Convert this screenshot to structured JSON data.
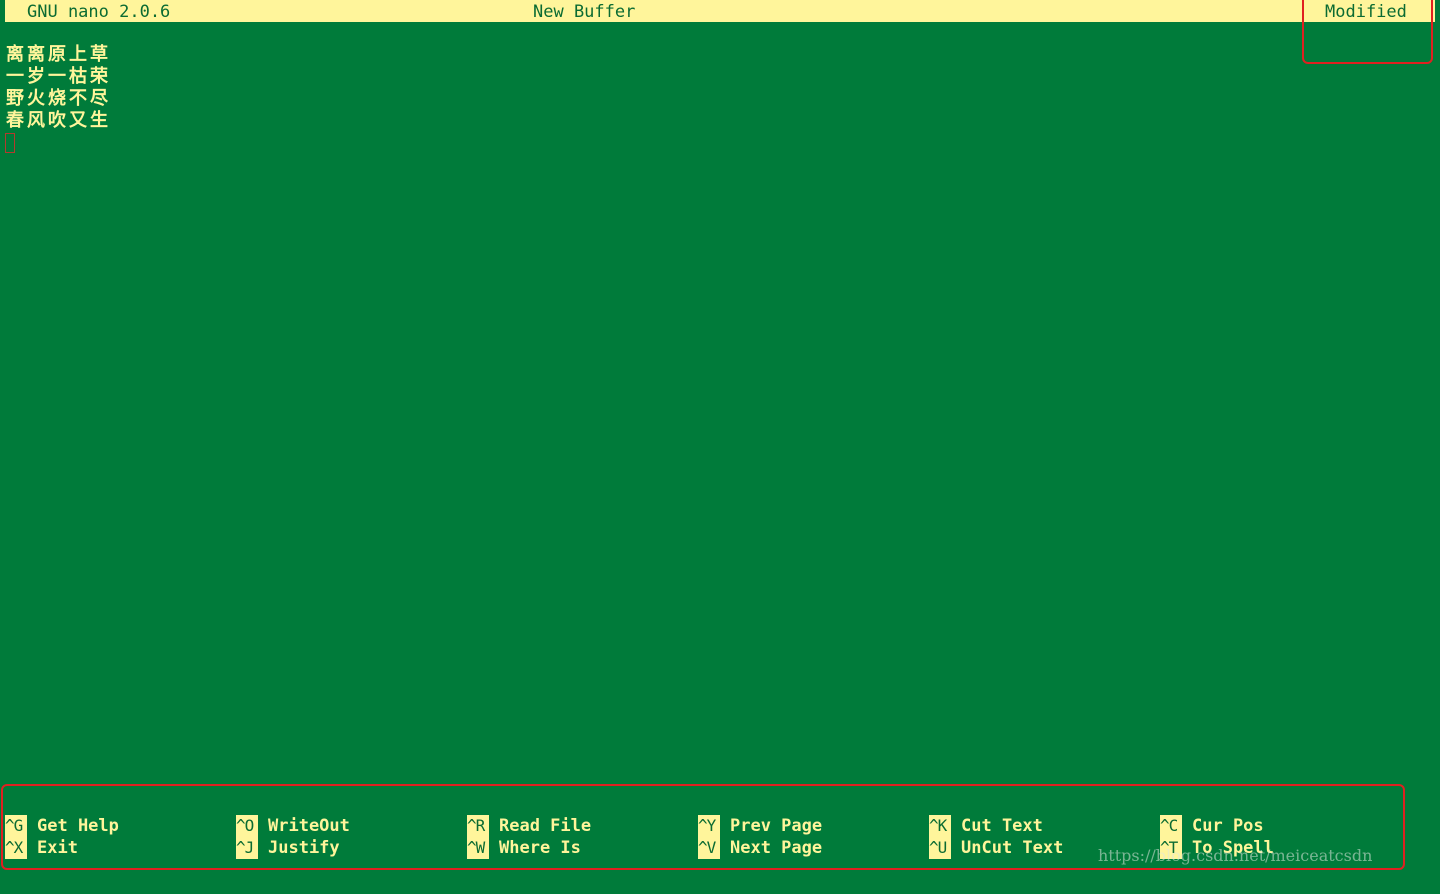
{
  "titlebar": {
    "app": "GNU nano 2.0.6",
    "buffer": "New Buffer",
    "status": "Modified"
  },
  "editor": {
    "lines": [
      "离离原上草",
      "一岁一枯荣",
      "野火烧不尽",
      "春风吹又生"
    ]
  },
  "shortcuts": {
    "row1": [
      {
        "key": "^G",
        "label": "Get Help"
      },
      {
        "key": "^O",
        "label": "WriteOut"
      },
      {
        "key": "^R",
        "label": "Read File"
      },
      {
        "key": "^Y",
        "label": "Prev Page"
      },
      {
        "key": "^K",
        "label": "Cut Text"
      },
      {
        "key": "^C",
        "label": "Cur Pos"
      }
    ],
    "row2": [
      {
        "key": "^X",
        "label": "Exit"
      },
      {
        "key": "^J",
        "label": "Justify"
      },
      {
        "key": "^W",
        "label": "Where Is"
      },
      {
        "key": "^V",
        "label": "Next Page"
      },
      {
        "key": "^U",
        "label": "UnCut Text"
      },
      {
        "key": "^T",
        "label": "To Spell"
      }
    ]
  },
  "watermark": "https://blog.csdn.net/meiceatcsdn",
  "colors": {
    "background": "#007b3a",
    "highlight": "#fff59b",
    "annotation": "#e02020"
  }
}
